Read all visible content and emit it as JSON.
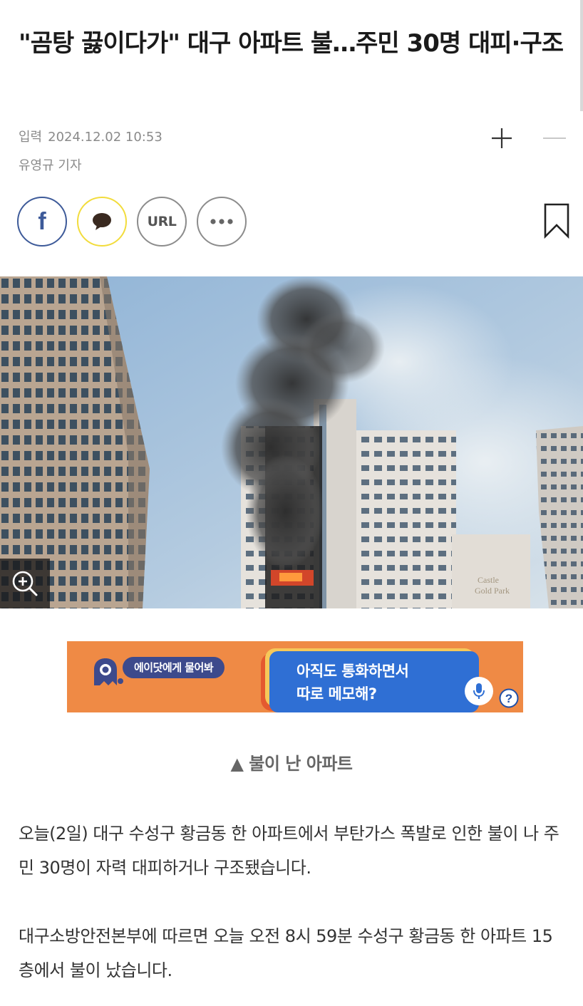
{
  "article": {
    "title": "\"곰탕 끓이다가\" 대구 아파트 불…주민 30명 대피·구조",
    "date_label": "입력",
    "date_value": "2024.12.02 10:53",
    "author": "유영규 기자",
    "photo_alt": "불이 난 아파트",
    "photo_sign_line1": "Castle",
    "photo_sign_line2": "Gold Park",
    "caption": "▲ 불이 난 아파트",
    "paragraphs": [
      "오늘(2일) 대구 수성구 황금동 한 아파트에서 부탄가스 폭발로 인한 불이 나 주민 30명이 자력 대피하거나 구조됐습니다.",
      "대구소방안전본부에 따르면 오늘 오전 8시 59분 수성구 황금동 한 아파트 15층에서 불이 났습니다."
    ]
  },
  "share": {
    "facebook_glyph": "f",
    "url_label": "URL"
  },
  "ad": {
    "pill_text": "에이닷에게 물어봐",
    "bubble_line1": "아직도 통화하면서",
    "bubble_line2": "따로 메모해?",
    "help_glyph": "?"
  },
  "colors": {
    "facebook": "#3d5a99",
    "kakao": "#f2dc3c",
    "ad_background": "#ef8a45",
    "ad_bubble": "#2f6fd4",
    "ad_pill": "#3d4a8c"
  },
  "icons": [
    "font-plus-icon",
    "font-minus-icon",
    "facebook-icon",
    "kakao-talk-icon",
    "more-dots-icon",
    "bookmark-icon",
    "zoom-in-icon",
    "microphone-icon",
    "help-icon",
    "robot-mascot-icon"
  ]
}
